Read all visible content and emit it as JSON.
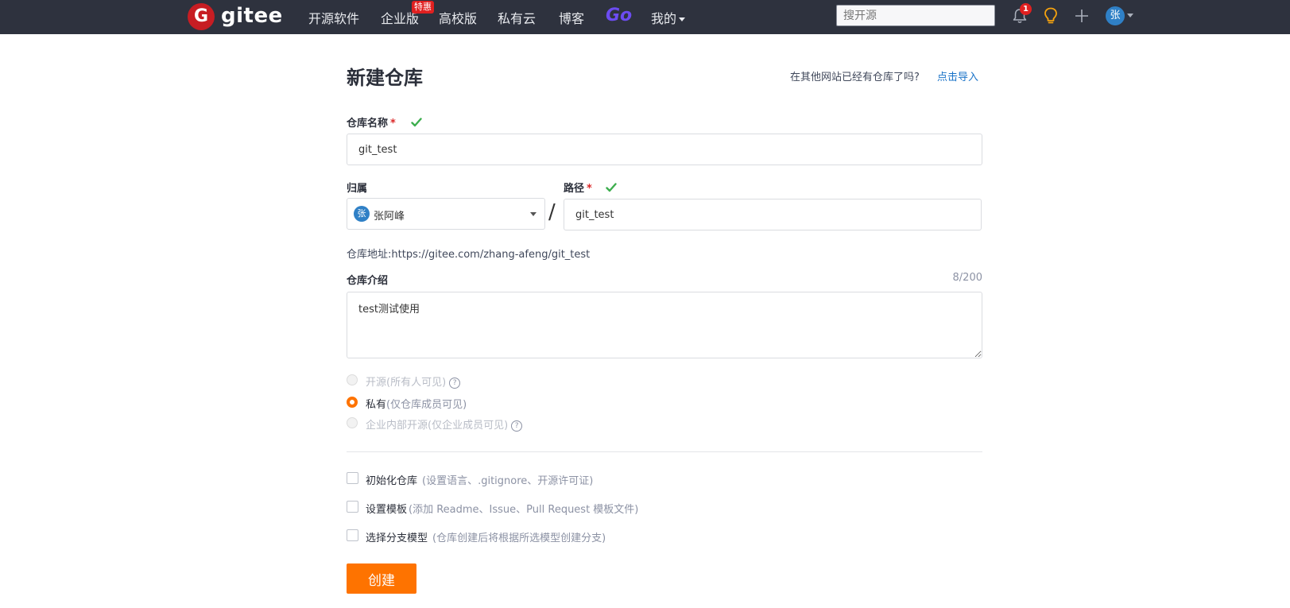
{
  "navbar": {
    "logo_letter": "G",
    "logo_text": "gitee",
    "items": [
      "开源软件",
      "企业版",
      "高校版",
      "私有云",
      "博客"
    ],
    "special_badge": "特惠",
    "go_label": "Go",
    "mine_label": "我的",
    "search_placeholder": "搜开源",
    "notification_count": "1",
    "avatar_initial": "张",
    "icons": [
      "bell-icon",
      "lightbulb-icon",
      "plus-icon",
      "caret-down-icon"
    ]
  },
  "form": {
    "title": "新建仓库",
    "import_question": "在其他网站已经有仓库了吗?",
    "import_link": "点击导入",
    "repo_name_label": "仓库名称",
    "repo_name_value": "git_test",
    "owner_label": "归属",
    "owner_avatar_initial": "张",
    "owner_name": "张阿峰",
    "separator": "/",
    "path_label": "路径",
    "path_value": "git_test",
    "required_mark": "*",
    "repo_url_prefix": "仓库地址:",
    "repo_url": "https://gitee.com/zhang-afeng/git_test",
    "intro_label": "仓库介绍",
    "intro_counter": "8/200",
    "intro_value": "test测试使用",
    "visibility": [
      {
        "label": "开源",
        "note": "(所有人可见)",
        "selected": false,
        "disabled": true,
        "help": true
      },
      {
        "label": "私有",
        "note": "(仅仓库成员可见)",
        "selected": true,
        "disabled": false,
        "help": false
      },
      {
        "label": "企业内部开源",
        "note": "(仅企业成员可见)",
        "selected": false,
        "disabled": true,
        "help": true
      }
    ],
    "help_glyph": "?",
    "options": [
      {
        "label": "初始化仓库",
        "note": "(设置语言、.gitignore、开源许可证)",
        "checked": false
      },
      {
        "label": "设置模板",
        "note": "(添加 Readme、Issue、Pull Request 模板文件)",
        "checked": false
      },
      {
        "label": "选择分支模型",
        "note": "(仓库创建后将根据所选模型创建分支)",
        "checked": false
      }
    ],
    "create_button": "创建"
  },
  "colors": {
    "navbar_bg": "#2e323e",
    "brand_red": "#c71d23",
    "accent_orange": "#fe7300",
    "link_blue": "#1a73c8",
    "check_green": "#3dae4e",
    "go_purple": "#6c4cf1"
  }
}
